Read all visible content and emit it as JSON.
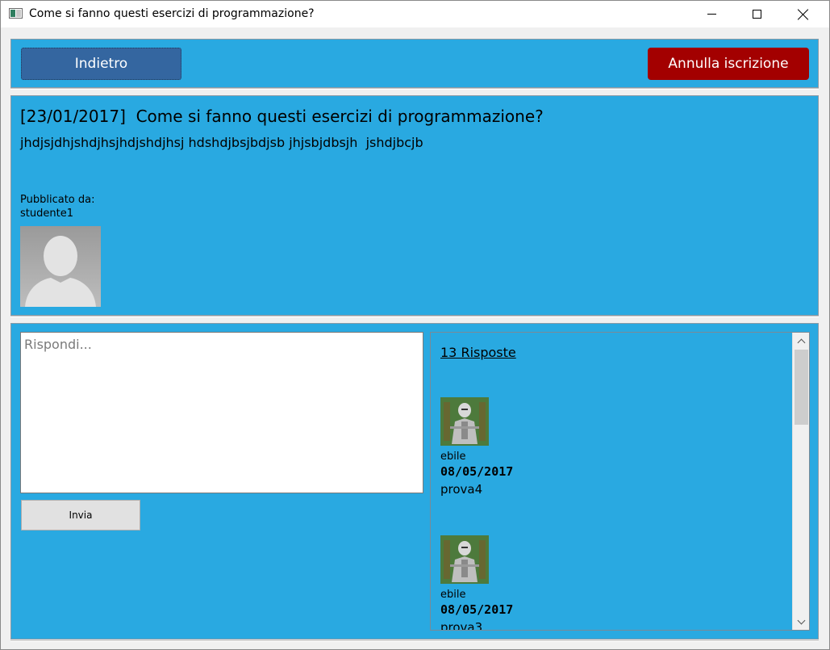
{
  "window": {
    "title": "Come si fanno questi esercizi di programmazione?"
  },
  "toolbar": {
    "back_label": "Indietro",
    "unsubscribe_label": "Annulla iscrizione"
  },
  "post": {
    "title": "[23/01/2017]  Come si fanno questi esercizi di programmazione?",
    "body": "jhdjsjdhjshdjhsjhdjshdjhsj hdshdjbsjbdjsb jhjsbjdbsjh  jshdjbcjb",
    "posted_by_label": "Pubblicato da:",
    "author": "studente1"
  },
  "reply": {
    "placeholder": "Rispondi...",
    "send_label": "Invia"
  },
  "answers": {
    "count_label": "13 Risposte",
    "items": [
      {
        "user": "ebile",
        "date": "08/05/2017",
        "text": "prova4"
      },
      {
        "user": "ebile",
        "date": "08/05/2017",
        "text": "prova3"
      }
    ]
  },
  "colors": {
    "panel_bg": "#29a9e1",
    "back_button": "#3466a0",
    "unsubscribe_button": "#a30000"
  }
}
